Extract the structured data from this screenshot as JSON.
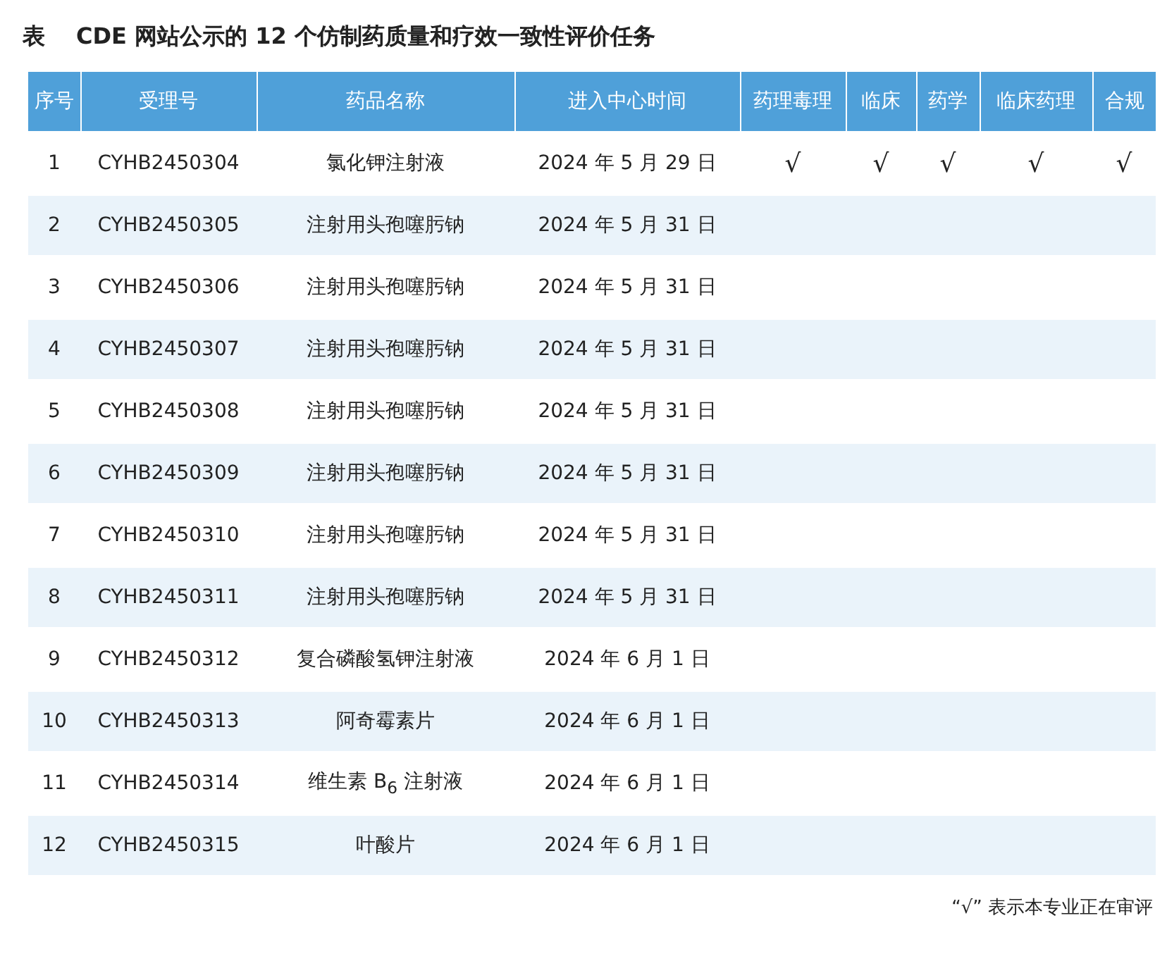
{
  "caption": {
    "label": "表",
    "title": "CDE 网站公示的 12 个仿制药质量和疗效一致性评价任务"
  },
  "table": {
    "columns": [
      "序号",
      "受理号",
      "药品名称",
      "进入中心时间",
      "药理毒理",
      "临床",
      "药学",
      "临床药理",
      "合规"
    ],
    "rows": [
      {
        "no": "1",
        "id": "CYHB2450304",
        "drug": "氯化钾注射液",
        "date": "2024 年 5 月 29 日",
        "marks": [
          true,
          true,
          true,
          true,
          true
        ]
      },
      {
        "no": "2",
        "id": "CYHB2450305",
        "drug": "注射用头孢噻肟钠",
        "date": "2024 年 5 月 31 日",
        "marks": [
          false,
          false,
          false,
          false,
          false
        ]
      },
      {
        "no": "3",
        "id": "CYHB2450306",
        "drug": "注射用头孢噻肟钠",
        "date": "2024 年 5 月 31 日",
        "marks": [
          false,
          false,
          false,
          false,
          false
        ]
      },
      {
        "no": "4",
        "id": "CYHB2450307",
        "drug": "注射用头孢噻肟钠",
        "date": "2024 年 5 月 31 日",
        "marks": [
          false,
          false,
          false,
          false,
          false
        ]
      },
      {
        "no": "5",
        "id": "CYHB2450308",
        "drug": "注射用头孢噻肟钠",
        "date": "2024 年 5 月 31 日",
        "marks": [
          false,
          false,
          false,
          false,
          false
        ]
      },
      {
        "no": "6",
        "id": "CYHB2450309",
        "drug": "注射用头孢噻肟钠",
        "date": "2024 年 5 月 31 日",
        "marks": [
          false,
          false,
          false,
          false,
          false
        ]
      },
      {
        "no": "7",
        "id": "CYHB2450310",
        "drug": "注射用头孢噻肟钠",
        "date": "2024 年 5 月 31 日",
        "marks": [
          false,
          false,
          false,
          false,
          false
        ]
      },
      {
        "no": "8",
        "id": "CYHB2450311",
        "drug": "注射用头孢噻肟钠",
        "date": "2024 年 5 月 31 日",
        "marks": [
          false,
          false,
          false,
          false,
          false
        ]
      },
      {
        "no": "9",
        "id": "CYHB2450312",
        "drug": "复合磷酸氢钾注射液",
        "date": "2024 年 6 月 1 日",
        "marks": [
          false,
          false,
          false,
          false,
          false
        ]
      },
      {
        "no": "10",
        "id": "CYHB2450313",
        "drug": "阿奇霉素片",
        "date": "2024 年 6 月 1 日",
        "marks": [
          false,
          false,
          false,
          false,
          false
        ]
      },
      {
        "no": "11",
        "id": "CYHB2450314",
        "drug": "维生素 B$_{6}$ 注射液",
        "date": "2024 年 6 月 1 日",
        "marks": [
          false,
          false,
          false,
          false,
          false
        ]
      },
      {
        "no": "12",
        "id": "CYHB2450315",
        "drug": "叶酸片",
        "date": "2024 年 6 月 1 日",
        "marks": [
          false,
          false,
          false,
          false,
          false
        ]
      }
    ]
  },
  "check_symbol": "√",
  "footnote": "“√” 表示本专业正在审评"
}
